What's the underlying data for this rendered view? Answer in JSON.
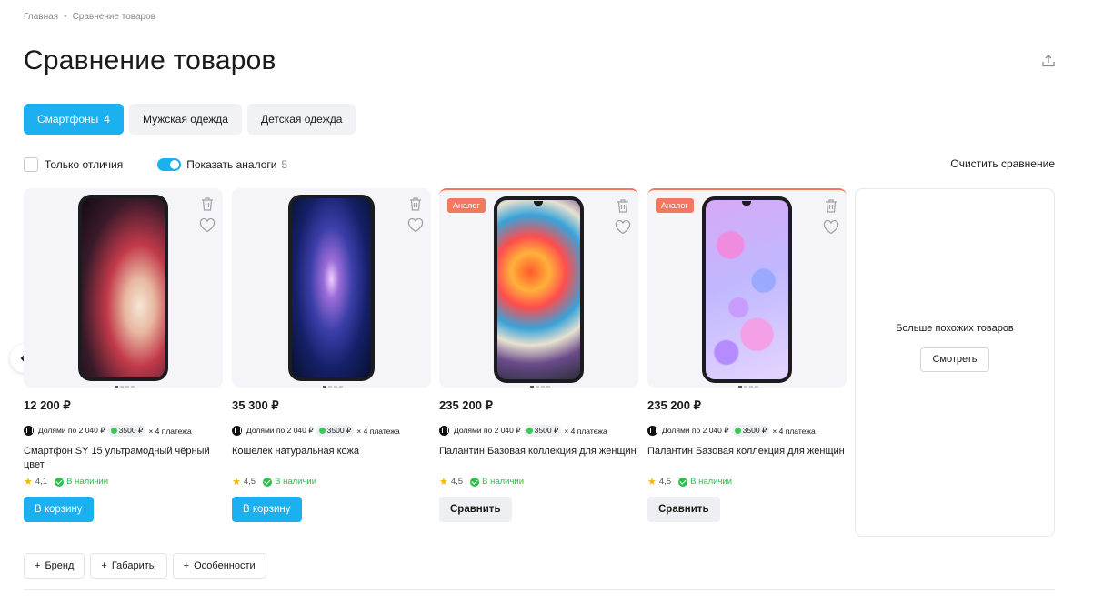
{
  "breadcrumb": [
    "Главная",
    "Сравнение товаров"
  ],
  "title": "Сравнение товаров",
  "tabs": [
    {
      "label": "Смартфоны",
      "count": "4",
      "active": true
    },
    {
      "label": "Мужская одежда",
      "count": "",
      "active": false
    },
    {
      "label": "Детская одежда",
      "count": "",
      "active": false
    }
  ],
  "filters": {
    "only_diff": "Только отличия",
    "show_analogs": "Показать аналоги",
    "analogs_count": "5",
    "clear": "Очистить сравнение"
  },
  "products": [
    {
      "price": "12 200 ₽",
      "installment_prefix": "Долями по 2 040 ₽",
      "installment_pill": "3500 ₽",
      "installment_suffix": "× 4 платежа",
      "name": "Смартфон SY 15 ультрамодный чёрный цвет",
      "rating": "4,1",
      "stock": "В наличии",
      "button": "В корзину",
      "badge": "",
      "screen": "pink"
    },
    {
      "price": "35 300 ₽",
      "installment_prefix": "Долями по 2 040 ₽",
      "installment_pill": "3500 ₽",
      "installment_suffix": "× 4 платежа",
      "name": "Кошелек натуральная кожа",
      "rating": "4,5",
      "stock": "В наличии",
      "button": "В корзину",
      "badge": "",
      "screen": "blue"
    },
    {
      "price": "235 200 ₽",
      "installment_prefix": "Долями по 2 040 ₽",
      "installment_pill": "3500 ₽",
      "installment_suffix": "× 4 платежа",
      "name": "Палантин Базовая коллекция для женщин",
      "rating": "4,5",
      "stock": "В наличии",
      "button": "Сравнить",
      "badge": "Аналог",
      "screen": "colorful"
    },
    {
      "price": "235 200 ₽",
      "installment_prefix": "Долями по 2 040 ₽",
      "installment_pill": "3500 ₽",
      "installment_suffix": "× 4 платежа",
      "name": "Палантин Базовая коллекция для женщин",
      "rating": "4,5",
      "stock": "В наличии",
      "button": "Сравнить",
      "badge": "Аналог",
      "screen": "bubbles"
    }
  ],
  "more": {
    "title": "Больше похожих товаров",
    "button": "Смотреть"
  },
  "chips": [
    "Бренд",
    "Габариты",
    "Особенности"
  ],
  "colors": {
    "accent": "#1bb0f0",
    "badge": "#f4785f",
    "stock": "#2dbe4a"
  }
}
